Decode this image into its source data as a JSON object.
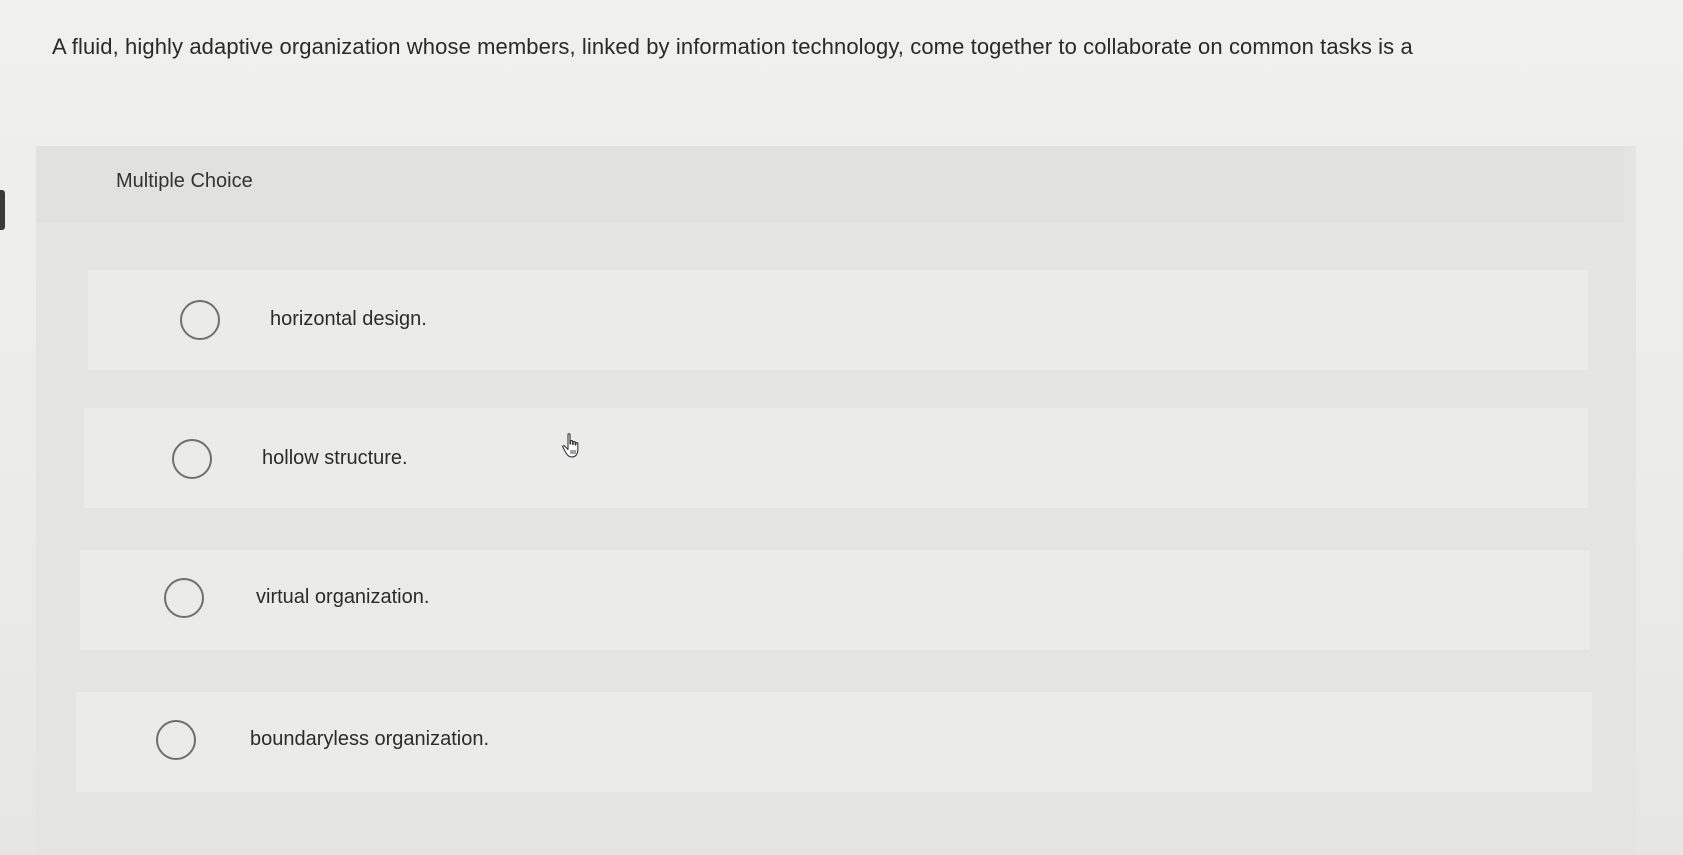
{
  "question": {
    "text": "A fluid, highly adaptive organization whose members, linked by information technology, come together to collaborate on common tasks is a"
  },
  "question_type": {
    "label": "Multiple Choice"
  },
  "options": [
    {
      "label": "horizontal design.",
      "selected": false
    },
    {
      "label": "hollow structure.",
      "selected": false
    },
    {
      "label": "virtual organization.",
      "selected": false
    },
    {
      "label": "boundaryless organization.",
      "selected": false
    }
  ],
  "colors": {
    "background": "#ededeb",
    "panel": "#e4e4e2",
    "option_bg": "#ebebea",
    "radio_border": "#6f6f6f",
    "text": "#2b2b2b"
  },
  "icons": {
    "cursor": "hand-pointer-icon",
    "radio": "radio-circle-icon"
  }
}
